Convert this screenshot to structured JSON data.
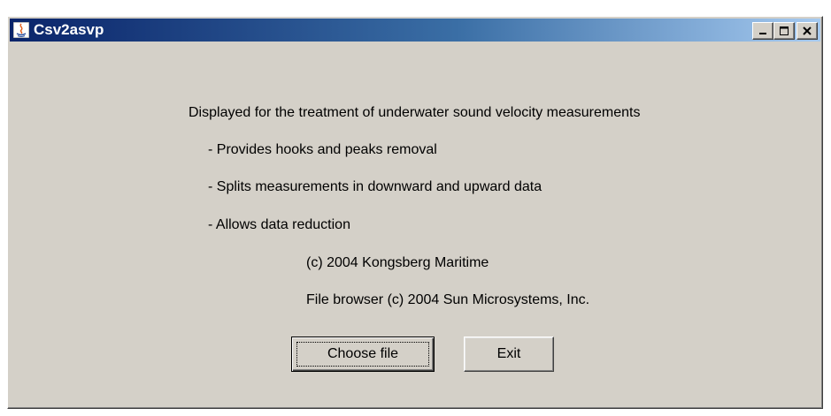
{
  "window": {
    "title": "Csv2asvp",
    "controls": {
      "minimize_icon": "minimize-icon",
      "maximize_icon": "maximize-icon",
      "close_icon": "close-icon"
    }
  },
  "content": {
    "lines": [
      "Displayed for the treatment of underwater sound velocity measurements",
      "- Provides hooks and peaks removal",
      "- Splits measurements in downward and upward data",
      "- Allows data reduction",
      "(c) 2004 Kongsberg Maritime",
      "File browser (c) 2004 Sun Microsystems, Inc."
    ]
  },
  "buttons": {
    "choose_file": "Choose file",
    "exit": "Exit"
  },
  "colors": {
    "titlebar_start": "#0a246a",
    "titlebar_end": "#a6caf0",
    "window_bg": "#d4d0c8"
  }
}
